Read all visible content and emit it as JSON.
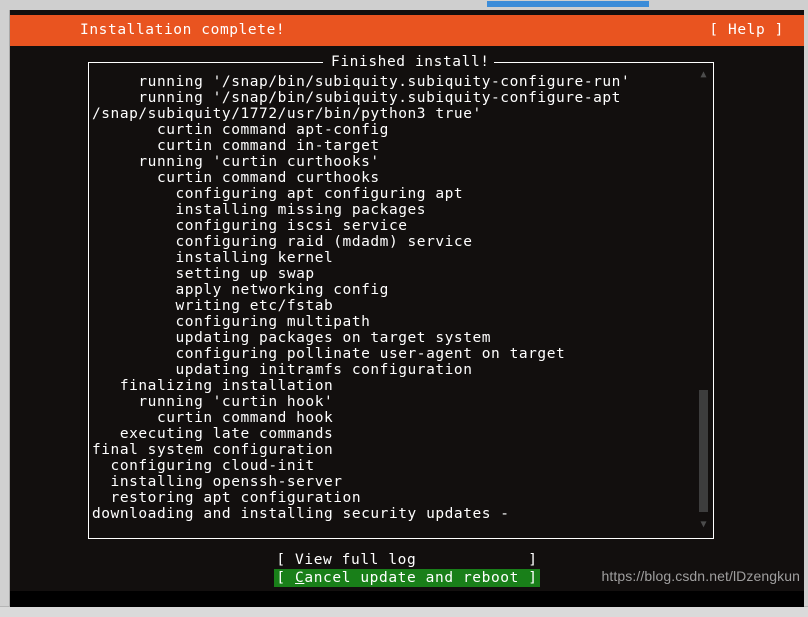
{
  "window": {
    "top_scrollbar": "horizontal-scrollbar"
  },
  "header": {
    "title": "Installation complete!",
    "help_label": "[ Help ]",
    "background_color": "#e95420",
    "text_color": "#ffffff"
  },
  "log_panel": {
    "title": "Finished install!",
    "lines": [
      "     running '/snap/bin/subiquity.subiquity-configure-run'",
      "     running '/snap/bin/subiquity.subiquity-configure-apt",
      "/snap/subiquity/1772/usr/bin/python3 true'",
      "       curtin command apt-config",
      "       curtin command in-target",
      "     running 'curtin curthooks'",
      "       curtin command curthooks",
      "         configuring apt configuring apt",
      "         installing missing packages",
      "         configuring iscsi service",
      "         configuring raid (mdadm) service",
      "         installing kernel",
      "         setting up swap",
      "         apply networking config",
      "         writing etc/fstab",
      "         configuring multipath",
      "         updating packages on target system",
      "         configuring pollinate user-agent on target",
      "         updating initramfs configuration",
      "   finalizing installation",
      "     running 'curtin hook'",
      "       curtin command hook",
      "   executing late commands",
      "final system configuration",
      "  configuring cloud-init",
      "  installing openssh-server",
      "  restoring apt configuration",
      "downloading and installing security updates -"
    ],
    "scrollbar": {
      "up_arrow": "▲",
      "down_arrow": "▼",
      "thumb_color": "#3d3d3d"
    }
  },
  "buttons": [
    {
      "label": "[ View full log            ]",
      "name": "view-full-log-button",
      "selected": false
    },
    {
      "prefix": "[ ",
      "accel": "C",
      "rest": "ancel update and reboot ]",
      "name": "cancel-update-and-reboot-button",
      "selected": true,
      "selected_color": "#197f19"
    }
  ],
  "watermark": {
    "text": "https://blog.csdn.net/lDzengkun"
  }
}
